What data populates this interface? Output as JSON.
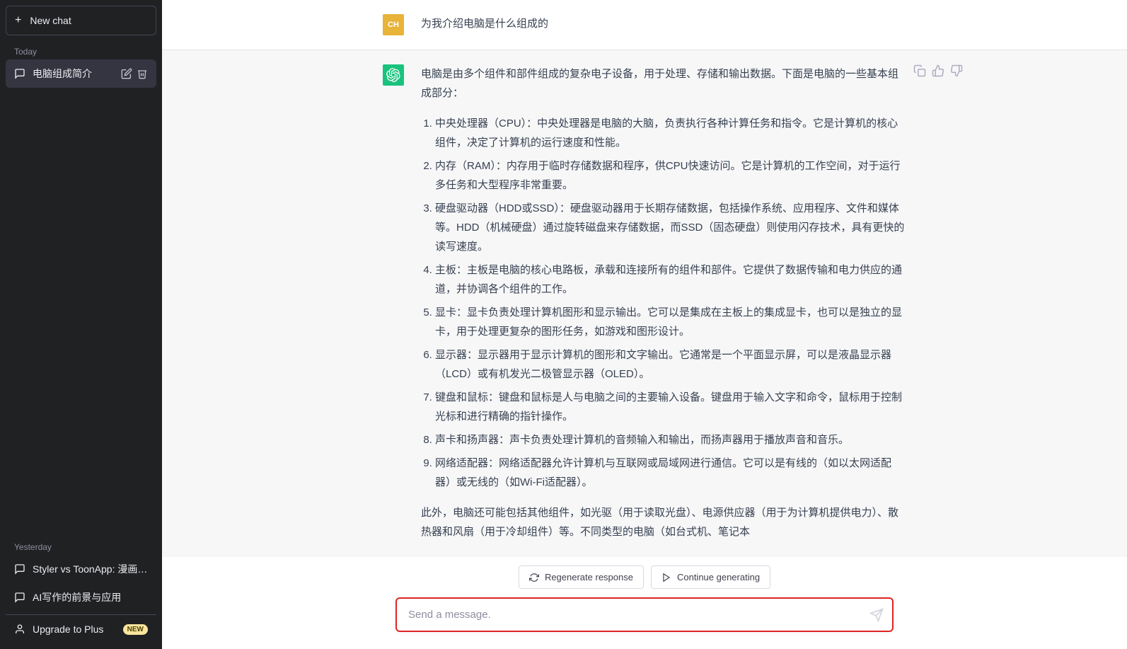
{
  "sidebar": {
    "new_chat_label": "New chat",
    "today_label": "Today",
    "yesterday_label": "Yesterday",
    "today_items": [
      {
        "title": "电脑组成简介",
        "active": true
      }
    ],
    "yesterday_items": [
      {
        "title": "Styler vs ToonApp: 漫画脸优势"
      },
      {
        "title": "AI写作的前景与应用"
      }
    ],
    "upgrade_label": "Upgrade to Plus",
    "upgrade_badge": "NEW"
  },
  "conversation": {
    "user_avatar_text": "CH",
    "user_message": "为我介绍电脑是什么组成的",
    "assistant_intro": "电脑是由多个组件和部件组成的复杂电子设备，用于处理、存储和输出数据。下面是电脑的一些基本组成部分：",
    "assistant_items": [
      "中央处理器（CPU）：中央处理器是电脑的大脑，负责执行各种计算任务和指令。它是计算机的核心组件，决定了计算机的运行速度和性能。",
      "内存（RAM）：内存用于临时存储数据和程序，供CPU快速访问。它是计算机的工作空间，对于运行多任务和大型程序非常重要。",
      "硬盘驱动器（HDD或SSD）：硬盘驱动器用于长期存储数据，包括操作系统、应用程序、文件和媒体等。HDD（机械硬盘）通过旋转磁盘来存储数据，而SSD（固态硬盘）则使用闪存技术，具有更快的读写速度。",
      "主板：主板是电脑的核心电路板，承载和连接所有的组件和部件。它提供了数据传输和电力供应的通道，并协调各个组件的工作。",
      "显卡：显卡负责处理计算机图形和显示输出。它可以是集成在主板上的集成显卡，也可以是独立的显卡，用于处理更复杂的图形任务，如游戏和图形设计。",
      "显示器：显示器用于显示计算机的图形和文字输出。它通常是一个平面显示屏，可以是液晶显示器（LCD）或有机发光二极管显示器（OLED）。",
      "键盘和鼠标：键盘和鼠标是人与电脑之间的主要输入设备。键盘用于输入文字和命令，鼠标用于控制光标和进行精确的指针操作。",
      "声卡和扬声器：声卡负责处理计算机的音频输入和输出，而扬声器用于播放声音和音乐。",
      "网络适配器：网络适配器允许计算机与互联网或局域网进行通信。它可以是有线的（如以太网适配器）或无线的（如Wi-Fi适配器）。"
    ],
    "assistant_outro": "此外，电脑还可能包括其他组件，如光驱（用于读取光盘）、电源供应器（用于为计算机提供电力）、散热器和风扇（用于冷却组件）等。不同类型的电脑（如台式机、笔记本"
  },
  "controls": {
    "regenerate_label": "Regenerate response",
    "continue_label": "Continue generating",
    "input_placeholder": "Send a message."
  }
}
